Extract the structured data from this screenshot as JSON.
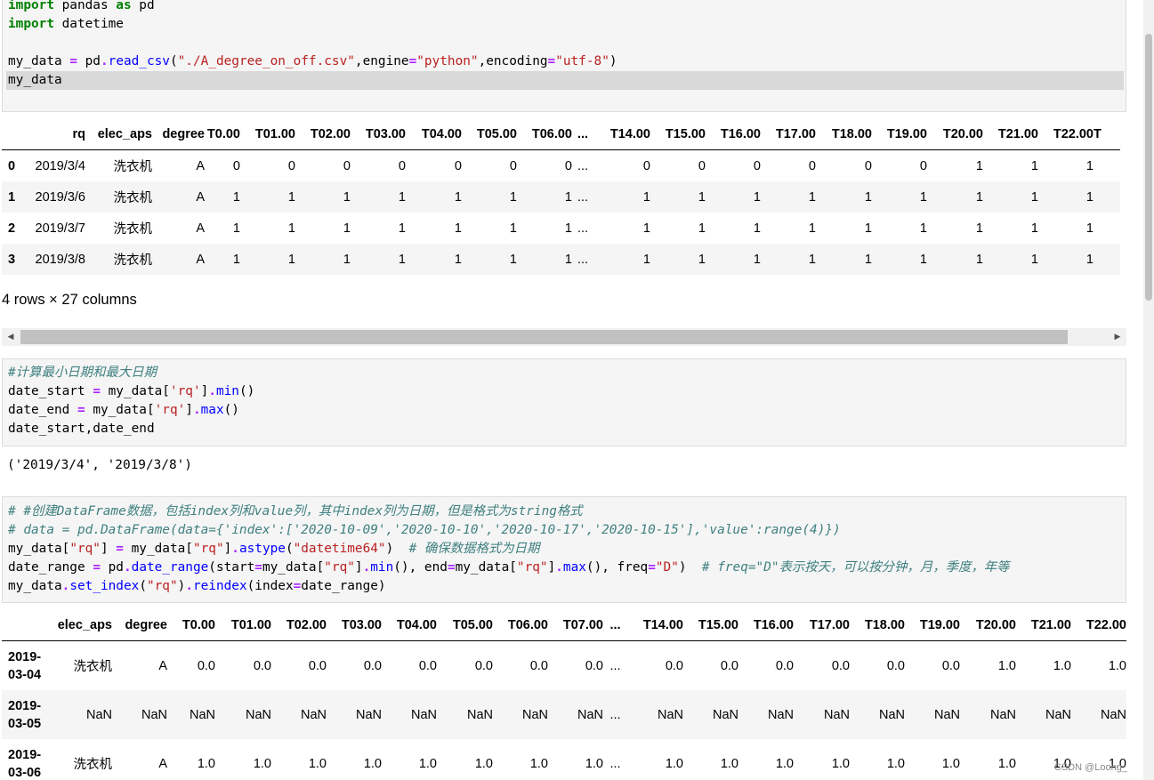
{
  "cell1": {
    "lines": [
      [
        {
          "t": "import",
          "c": "kw"
        },
        {
          "t": " pandas "
        },
        {
          "t": "as",
          "c": "kw"
        },
        {
          "t": " pd"
        }
      ],
      [
        {
          "t": "import",
          "c": "kw"
        },
        {
          "t": " datetime"
        }
      ],
      [],
      [
        {
          "t": "my_data "
        },
        {
          "t": "=",
          "c": "op"
        },
        {
          "t": " pd"
        },
        {
          "t": ".",
          "c": "op"
        },
        {
          "t": "read_csv",
          "c": "fn"
        },
        {
          "t": "("
        },
        {
          "t": "\"./A_degree_on_off.csv\"",
          "c": "st"
        },
        {
          "t": ",engine"
        },
        {
          "t": "=",
          "c": "op"
        },
        {
          "t": "\"python\"",
          "c": "st"
        },
        {
          "t": ",encoding"
        },
        {
          "t": "=",
          "c": "op"
        },
        {
          "t": "\"utf-8\"",
          "c": "st"
        },
        {
          "t": ")"
        }
      ],
      [
        {
          "t": "my_data"
        }
      ]
    ]
  },
  "table1": {
    "columns": [
      "",
      "rq",
      "elec_aps",
      "degree",
      "T0.00",
      "T01.00",
      "T02.00",
      "T03.00",
      "T04.00",
      "T05.00",
      "T06.00",
      "...",
      "T14.00",
      "T15.00",
      "T16.00",
      "T17.00",
      "T18.00",
      "T19.00",
      "T20.00",
      "T21.00",
      "T22.00",
      "T"
    ],
    "rows": [
      [
        "0",
        "2019/3/4",
        "洗衣机",
        "A",
        "0",
        "0",
        "0",
        "0",
        "0",
        "0",
        "0",
        "...",
        "0",
        "0",
        "0",
        "0",
        "0",
        "0",
        "1",
        "1",
        "1",
        ""
      ],
      [
        "1",
        "2019/3/6",
        "洗衣机",
        "A",
        "1",
        "1",
        "1",
        "1",
        "1",
        "1",
        "1",
        "...",
        "1",
        "1",
        "1",
        "1",
        "1",
        "1",
        "1",
        "1",
        "1",
        ""
      ],
      [
        "2",
        "2019/3/7",
        "洗衣机",
        "A",
        "1",
        "1",
        "1",
        "1",
        "1",
        "1",
        "1",
        "...",
        "1",
        "1",
        "1",
        "1",
        "1",
        "1",
        "1",
        "1",
        "1",
        ""
      ],
      [
        "3",
        "2019/3/8",
        "洗衣机",
        "A",
        "1",
        "1",
        "1",
        "1",
        "1",
        "1",
        "1",
        "...",
        "1",
        "1",
        "1",
        "1",
        "1",
        "1",
        "1",
        "1",
        "1",
        ""
      ]
    ],
    "note": "4 rows × 27 columns"
  },
  "cell2": {
    "lines": [
      [
        {
          "t": "#计算最小日期和最大日期",
          "c": "cm"
        }
      ],
      [
        {
          "t": "date_start "
        },
        {
          "t": "=",
          "c": "op"
        },
        {
          "t": " my_data["
        },
        {
          "t": "'rq'",
          "c": "st"
        },
        {
          "t": "]"
        },
        {
          "t": ".",
          "c": "op"
        },
        {
          "t": "min",
          "c": "fn"
        },
        {
          "t": "()"
        }
      ],
      [
        {
          "t": "date_end "
        },
        {
          "t": "=",
          "c": "op"
        },
        {
          "t": " my_data["
        },
        {
          "t": "'rq'",
          "c": "st"
        },
        {
          "t": "]"
        },
        {
          "t": ".",
          "c": "op"
        },
        {
          "t": "max",
          "c": "fn"
        },
        {
          "t": "()"
        }
      ],
      [
        {
          "t": "date_start,date_end"
        }
      ]
    ],
    "output": "('2019/3/4', '2019/3/8')"
  },
  "cell3": {
    "lines": [
      [
        {
          "t": "# #创建DataFrame数据，包括index列和value列，其中index列为日期，但是格式为string格式",
          "c": "cm"
        }
      ],
      [
        {
          "t": "# data = pd.DataFrame(data={'index':['2020-10-09','2020-10-10','2020-10-17','2020-10-15'],'value':range(4)})",
          "c": "cm"
        }
      ],
      [
        {
          "t": "my_data["
        },
        {
          "t": "\"rq\"",
          "c": "st"
        },
        {
          "t": "] "
        },
        {
          "t": "=",
          "c": "op"
        },
        {
          "t": " my_data["
        },
        {
          "t": "\"rq\"",
          "c": "st"
        },
        {
          "t": "]"
        },
        {
          "t": ".",
          "c": "op"
        },
        {
          "t": "astype",
          "c": "fn"
        },
        {
          "t": "("
        },
        {
          "t": "\"datetime64\"",
          "c": "st"
        },
        {
          "t": ")  "
        },
        {
          "t": "# 确保数据格式为日期",
          "c": "cm"
        }
      ],
      [
        {
          "t": "date_range "
        },
        {
          "t": "=",
          "c": "op"
        },
        {
          "t": " pd"
        },
        {
          "t": ".",
          "c": "op"
        },
        {
          "t": "date_range",
          "c": "fn"
        },
        {
          "t": "(start"
        },
        {
          "t": "=",
          "c": "op"
        },
        {
          "t": "my_data["
        },
        {
          "t": "\"rq\"",
          "c": "st"
        },
        {
          "t": "]"
        },
        {
          "t": ".",
          "c": "op"
        },
        {
          "t": "min",
          "c": "fn"
        },
        {
          "t": "(), end"
        },
        {
          "t": "=",
          "c": "op"
        },
        {
          "t": "my_data["
        },
        {
          "t": "\"rq\"",
          "c": "st"
        },
        {
          "t": "]"
        },
        {
          "t": ".",
          "c": "op"
        },
        {
          "t": "max",
          "c": "fn"
        },
        {
          "t": "(), freq"
        },
        {
          "t": "=",
          "c": "op"
        },
        {
          "t": "\"D\"",
          "c": "st"
        },
        {
          "t": ")  "
        },
        {
          "t": "# freq=\"D\"表示按天，可以按分钟，月，季度，年等",
          "c": "cm"
        }
      ],
      [
        {
          "t": "my_data"
        },
        {
          "t": ".",
          "c": "op"
        },
        {
          "t": "set_index",
          "c": "fn"
        },
        {
          "t": "("
        },
        {
          "t": "\"rq\"",
          "c": "st"
        },
        {
          "t": ")"
        },
        {
          "t": ".",
          "c": "op"
        },
        {
          "t": "reindex",
          "c": "fn"
        },
        {
          "t": "(index"
        },
        {
          "t": "=",
          "c": "op"
        },
        {
          "t": "date_range)"
        }
      ]
    ]
  },
  "table2": {
    "columns": [
      "",
      "elec_aps",
      "degree",
      "T0.00",
      "T01.00",
      "T02.00",
      "T03.00",
      "T04.00",
      "T05.00",
      "T06.00",
      "T07.00",
      "...",
      "T14.00",
      "T15.00",
      "T16.00",
      "T17.00",
      "T18.00",
      "T19.00",
      "T20.00",
      "T21.00",
      "T22.00"
    ],
    "rows": [
      [
        [
          "2019-",
          "03-04"
        ],
        "洗衣机",
        "A",
        "0.0",
        "0.0",
        "0.0",
        "0.0",
        "0.0",
        "0.0",
        "0.0",
        "0.0",
        "...",
        "0.0",
        "0.0",
        "0.0",
        "0.0",
        "0.0",
        "0.0",
        "1.0",
        "1.0",
        "1.0"
      ],
      [
        [
          "2019-",
          "03-05"
        ],
        "NaN",
        "NaN",
        "NaN",
        "NaN",
        "NaN",
        "NaN",
        "NaN",
        "NaN",
        "NaN",
        "NaN",
        "...",
        "NaN",
        "NaN",
        "NaN",
        "NaN",
        "NaN",
        "NaN",
        "NaN",
        "NaN",
        "NaN"
      ],
      [
        [
          "2019-",
          "03-06"
        ],
        "洗衣机",
        "A",
        "1.0",
        "1.0",
        "1.0",
        "1.0",
        "1.0",
        "1.0",
        "1.0",
        "1.0",
        "...",
        "1.0",
        "1.0",
        "1.0",
        "1.0",
        "1.0",
        "1.0",
        "1.0",
        "1.0",
        "1.0"
      ]
    ]
  },
  "watermark": "CSDN @Loong_"
}
